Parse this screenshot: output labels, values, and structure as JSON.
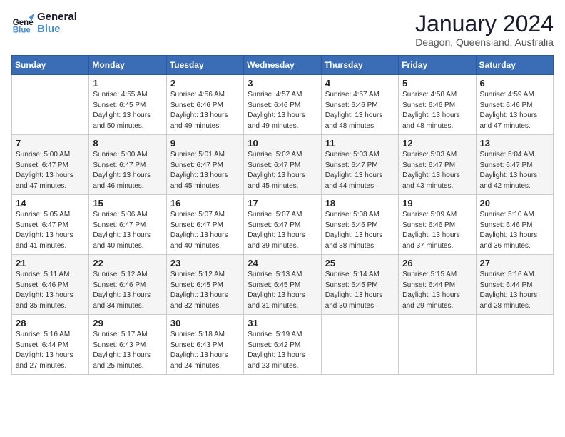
{
  "logo": {
    "line1": "General",
    "line2": "Blue"
  },
  "title": "January 2024",
  "subtitle": "Deagon, Queensland, Australia",
  "weekdays": [
    "Sunday",
    "Monday",
    "Tuesday",
    "Wednesday",
    "Thursday",
    "Friday",
    "Saturday"
  ],
  "weeks": [
    [
      {
        "day": "",
        "info": ""
      },
      {
        "day": "1",
        "info": "Sunrise: 4:55 AM\nSunset: 6:45 PM\nDaylight: 13 hours\nand 50 minutes."
      },
      {
        "day": "2",
        "info": "Sunrise: 4:56 AM\nSunset: 6:46 PM\nDaylight: 13 hours\nand 49 minutes."
      },
      {
        "day": "3",
        "info": "Sunrise: 4:57 AM\nSunset: 6:46 PM\nDaylight: 13 hours\nand 49 minutes."
      },
      {
        "day": "4",
        "info": "Sunrise: 4:57 AM\nSunset: 6:46 PM\nDaylight: 13 hours\nand 48 minutes."
      },
      {
        "day": "5",
        "info": "Sunrise: 4:58 AM\nSunset: 6:46 PM\nDaylight: 13 hours\nand 48 minutes."
      },
      {
        "day": "6",
        "info": "Sunrise: 4:59 AM\nSunset: 6:46 PM\nDaylight: 13 hours\nand 47 minutes."
      }
    ],
    [
      {
        "day": "7",
        "info": "Sunrise: 5:00 AM\nSunset: 6:47 PM\nDaylight: 13 hours\nand 47 minutes."
      },
      {
        "day": "8",
        "info": "Sunrise: 5:00 AM\nSunset: 6:47 PM\nDaylight: 13 hours\nand 46 minutes."
      },
      {
        "day": "9",
        "info": "Sunrise: 5:01 AM\nSunset: 6:47 PM\nDaylight: 13 hours\nand 45 minutes."
      },
      {
        "day": "10",
        "info": "Sunrise: 5:02 AM\nSunset: 6:47 PM\nDaylight: 13 hours\nand 45 minutes."
      },
      {
        "day": "11",
        "info": "Sunrise: 5:03 AM\nSunset: 6:47 PM\nDaylight: 13 hours\nand 44 minutes."
      },
      {
        "day": "12",
        "info": "Sunrise: 5:03 AM\nSunset: 6:47 PM\nDaylight: 13 hours\nand 43 minutes."
      },
      {
        "day": "13",
        "info": "Sunrise: 5:04 AM\nSunset: 6:47 PM\nDaylight: 13 hours\nand 42 minutes."
      }
    ],
    [
      {
        "day": "14",
        "info": "Sunrise: 5:05 AM\nSunset: 6:47 PM\nDaylight: 13 hours\nand 41 minutes."
      },
      {
        "day": "15",
        "info": "Sunrise: 5:06 AM\nSunset: 6:47 PM\nDaylight: 13 hours\nand 40 minutes."
      },
      {
        "day": "16",
        "info": "Sunrise: 5:07 AM\nSunset: 6:47 PM\nDaylight: 13 hours\nand 40 minutes."
      },
      {
        "day": "17",
        "info": "Sunrise: 5:07 AM\nSunset: 6:47 PM\nDaylight: 13 hours\nand 39 minutes."
      },
      {
        "day": "18",
        "info": "Sunrise: 5:08 AM\nSunset: 6:46 PM\nDaylight: 13 hours\nand 38 minutes."
      },
      {
        "day": "19",
        "info": "Sunrise: 5:09 AM\nSunset: 6:46 PM\nDaylight: 13 hours\nand 37 minutes."
      },
      {
        "day": "20",
        "info": "Sunrise: 5:10 AM\nSunset: 6:46 PM\nDaylight: 13 hours\nand 36 minutes."
      }
    ],
    [
      {
        "day": "21",
        "info": "Sunrise: 5:11 AM\nSunset: 6:46 PM\nDaylight: 13 hours\nand 35 minutes."
      },
      {
        "day": "22",
        "info": "Sunrise: 5:12 AM\nSunset: 6:46 PM\nDaylight: 13 hours\nand 34 minutes."
      },
      {
        "day": "23",
        "info": "Sunrise: 5:12 AM\nSunset: 6:45 PM\nDaylight: 13 hours\nand 32 minutes."
      },
      {
        "day": "24",
        "info": "Sunrise: 5:13 AM\nSunset: 6:45 PM\nDaylight: 13 hours\nand 31 minutes."
      },
      {
        "day": "25",
        "info": "Sunrise: 5:14 AM\nSunset: 6:45 PM\nDaylight: 13 hours\nand 30 minutes."
      },
      {
        "day": "26",
        "info": "Sunrise: 5:15 AM\nSunset: 6:44 PM\nDaylight: 13 hours\nand 29 minutes."
      },
      {
        "day": "27",
        "info": "Sunrise: 5:16 AM\nSunset: 6:44 PM\nDaylight: 13 hours\nand 28 minutes."
      }
    ],
    [
      {
        "day": "28",
        "info": "Sunrise: 5:16 AM\nSunset: 6:44 PM\nDaylight: 13 hours\nand 27 minutes."
      },
      {
        "day": "29",
        "info": "Sunrise: 5:17 AM\nSunset: 6:43 PM\nDaylight: 13 hours\nand 25 minutes."
      },
      {
        "day": "30",
        "info": "Sunrise: 5:18 AM\nSunset: 6:43 PM\nDaylight: 13 hours\nand 24 minutes."
      },
      {
        "day": "31",
        "info": "Sunrise: 5:19 AM\nSunset: 6:42 PM\nDaylight: 13 hours\nand 23 minutes."
      },
      {
        "day": "",
        "info": ""
      },
      {
        "day": "",
        "info": ""
      },
      {
        "day": "",
        "info": ""
      }
    ]
  ]
}
